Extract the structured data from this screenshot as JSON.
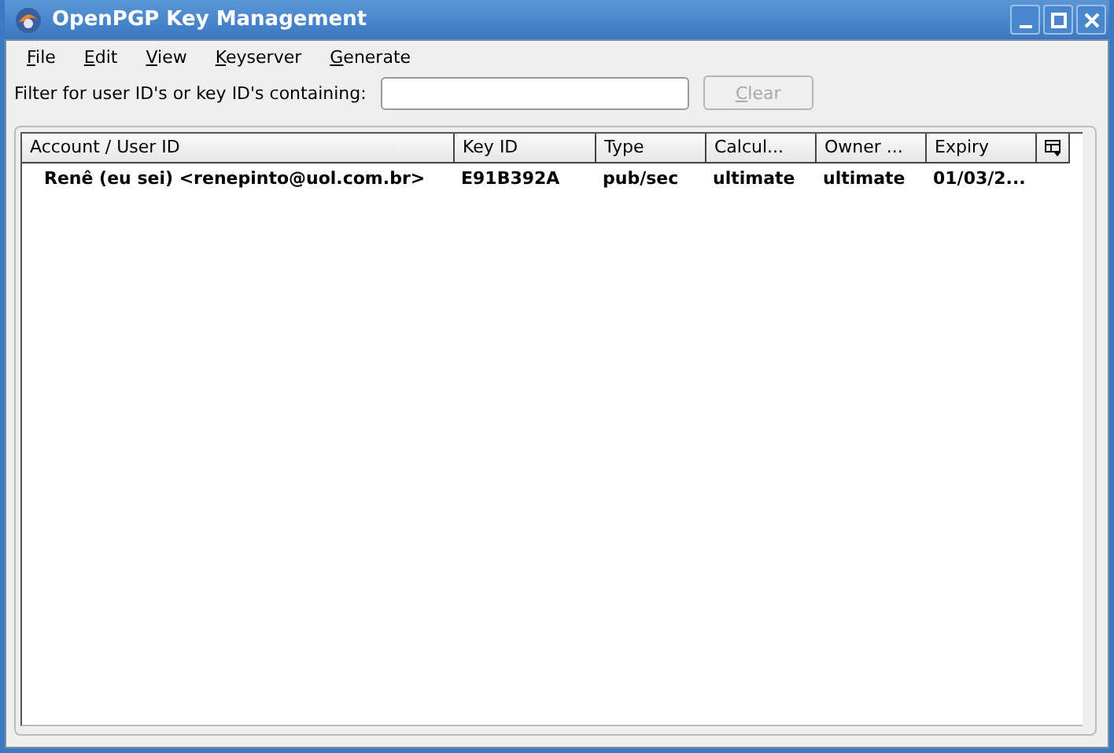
{
  "window": {
    "title": "OpenPGP Key Management"
  },
  "menu": [
    {
      "label": "File"
    },
    {
      "label": "Edit"
    },
    {
      "label": "View"
    },
    {
      "label": "Keyserver"
    },
    {
      "label": "Generate"
    }
  ],
  "filter": {
    "label": "Filter for user ID's or key ID's containing:",
    "clear_button": {
      "label": "Clear",
      "disabled": true
    }
  },
  "table": {
    "columns": [
      "Account / User ID",
      "Key ID",
      "Type",
      "Calcul...",
      "Owner ...",
      "Expiry"
    ],
    "rows": [
      {
        "cells": [
          "Renê (eu sei) <renepinto@uol.com.br>",
          "E91B392A",
          "pub/sec",
          "ultimate",
          "ultimate",
          "01/03/2..."
        ],
        "selected": false
      }
    ]
  }
}
